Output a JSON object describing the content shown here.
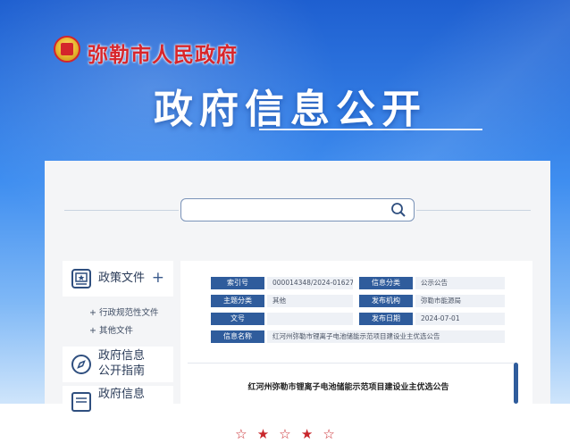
{
  "header": {
    "gov_name": "弥勒市人民政府",
    "title": "政府信息公开"
  },
  "search": {
    "value": "",
    "placeholder": ""
  },
  "sidebar": {
    "policy": {
      "title": "政策文件",
      "plus": "+"
    },
    "sub_items": [
      "+ 行政规范性文件",
      "+ 其他文件"
    ],
    "guide": {
      "line1": "政府信息",
      "line2": "公开指南"
    },
    "third": {
      "line1": "政府信息"
    }
  },
  "meta": {
    "index_no_label": "索引号",
    "index_no": "000014348/2024-01627",
    "info_category_label": "信息分类",
    "info_category": "公示公告",
    "topic_label": "主题分类",
    "topic": "其他",
    "issuer_label": "发布机构",
    "issuer": "弥勒市能源局",
    "doc_no_label": "文号",
    "doc_no": "",
    "date_label": "发布日期",
    "date": "2024-07-01",
    "name_label": "信息名称",
    "name": "红河州弥勒市锂离子电池储能示范项目建设业主优选公告"
  },
  "document": {
    "title": "红河州弥勒市锂离子电池储能示范项目建设业主优选公告"
  },
  "footer": {
    "stars": [
      "☆",
      "★",
      "☆",
      "★",
      "☆"
    ]
  },
  "colors": {
    "accent_blue": "#2f5c9c",
    "gov_red": "#d8262b"
  }
}
